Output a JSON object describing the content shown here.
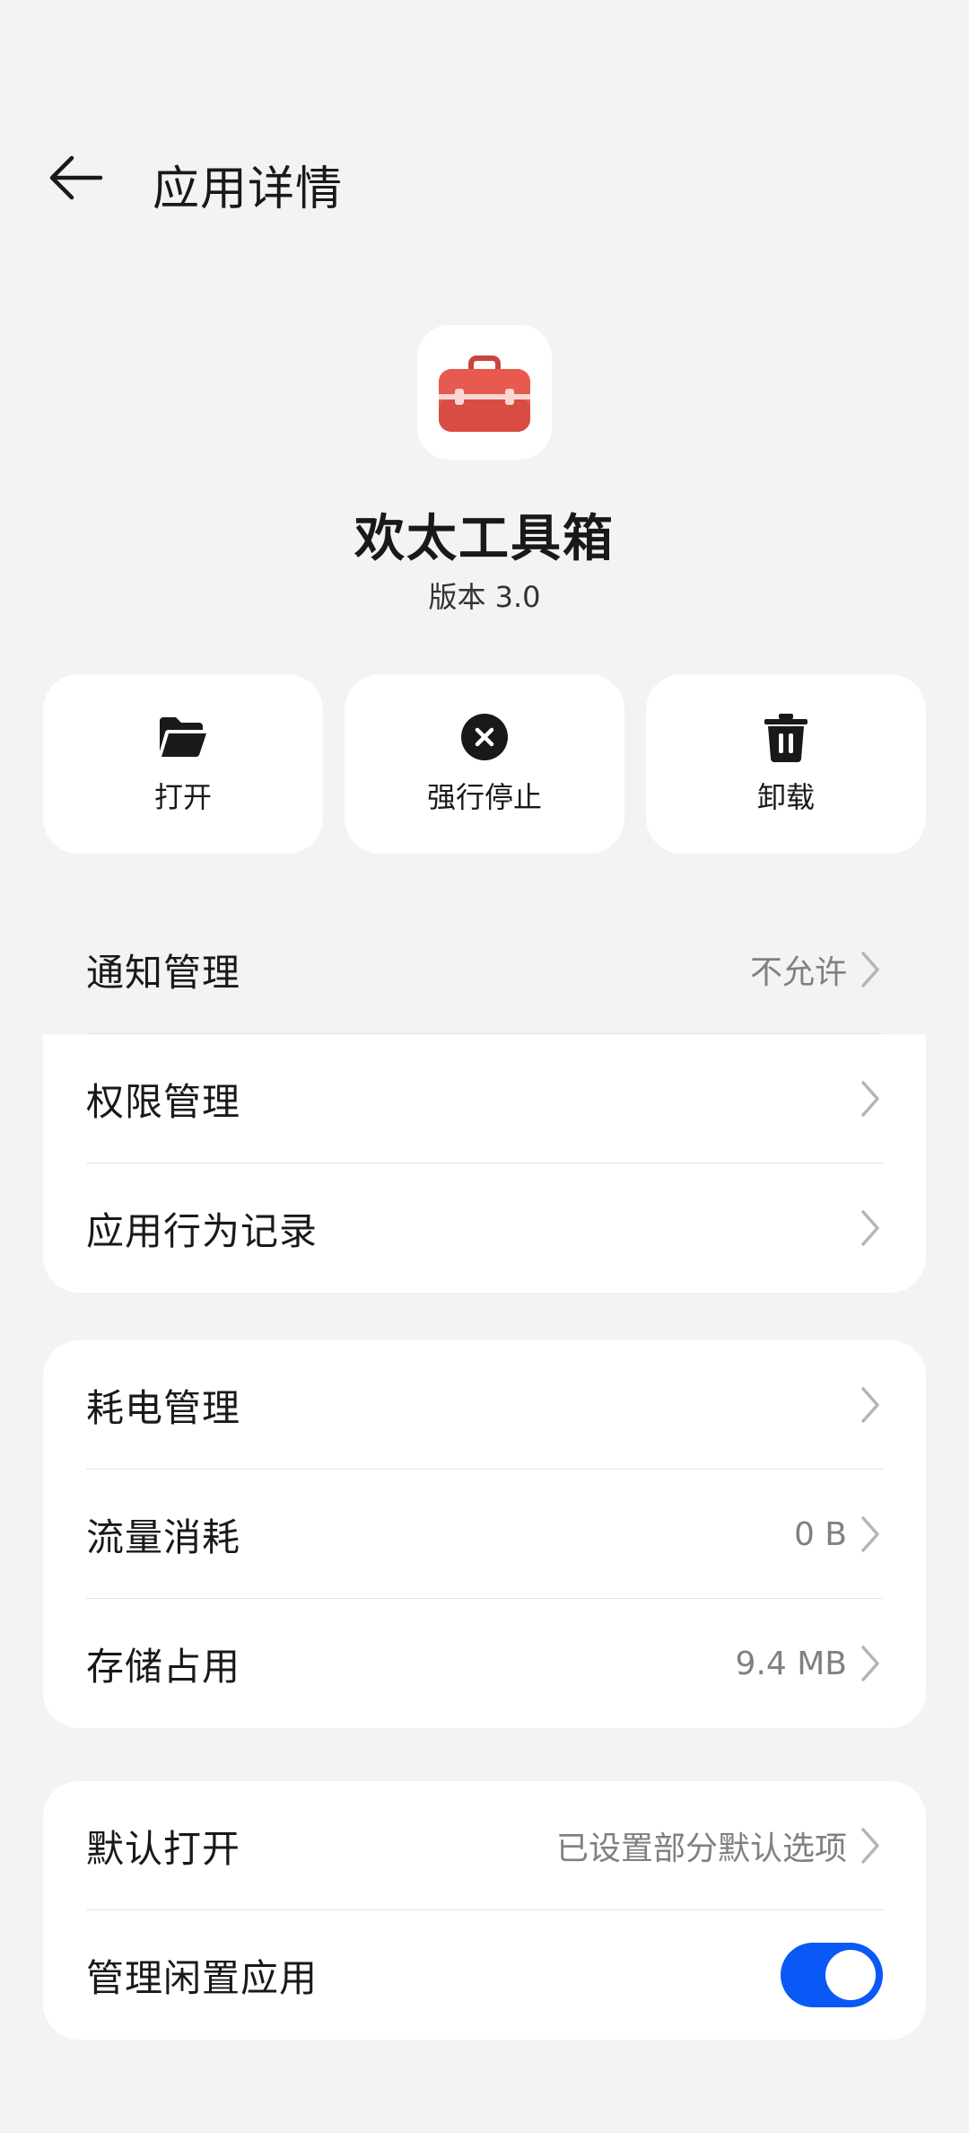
{
  "header": {
    "back_icon": "arrow-left-icon",
    "title": "应用详情"
  },
  "app": {
    "icon": "toolbox-icon",
    "icon_color": "#e85a50",
    "name": "欢太工具箱",
    "version": "版本 3.0"
  },
  "actions": [
    {
      "label": "打开",
      "icon": "folder-open-icon"
    },
    {
      "label": "强行停止",
      "icon": "close-circle-icon"
    },
    {
      "label": "卸载",
      "icon": "trash-icon"
    }
  ],
  "group1": {
    "items": [
      {
        "label": "通知管理",
        "value": "不允许"
      },
      {
        "label": "权限管理",
        "value": ""
      },
      {
        "label": "应用行为记录",
        "value": ""
      }
    ]
  },
  "group2": {
    "items": [
      {
        "label": "耗电管理",
        "value": ""
      },
      {
        "label": "流量消耗",
        "value": "0 B"
      },
      {
        "label": "存储占用",
        "value": "9.4 MB"
      }
    ]
  },
  "group3": {
    "items": [
      {
        "label": "默认打开",
        "value": "已设置部分默认选项"
      },
      {
        "label": "管理闲置应用",
        "toggle_on": true
      }
    ]
  },
  "colors": {
    "accent": "#0a59f7",
    "background": "#f1f3f5",
    "card": "#ffffff",
    "secondary_text": "#808080"
  }
}
